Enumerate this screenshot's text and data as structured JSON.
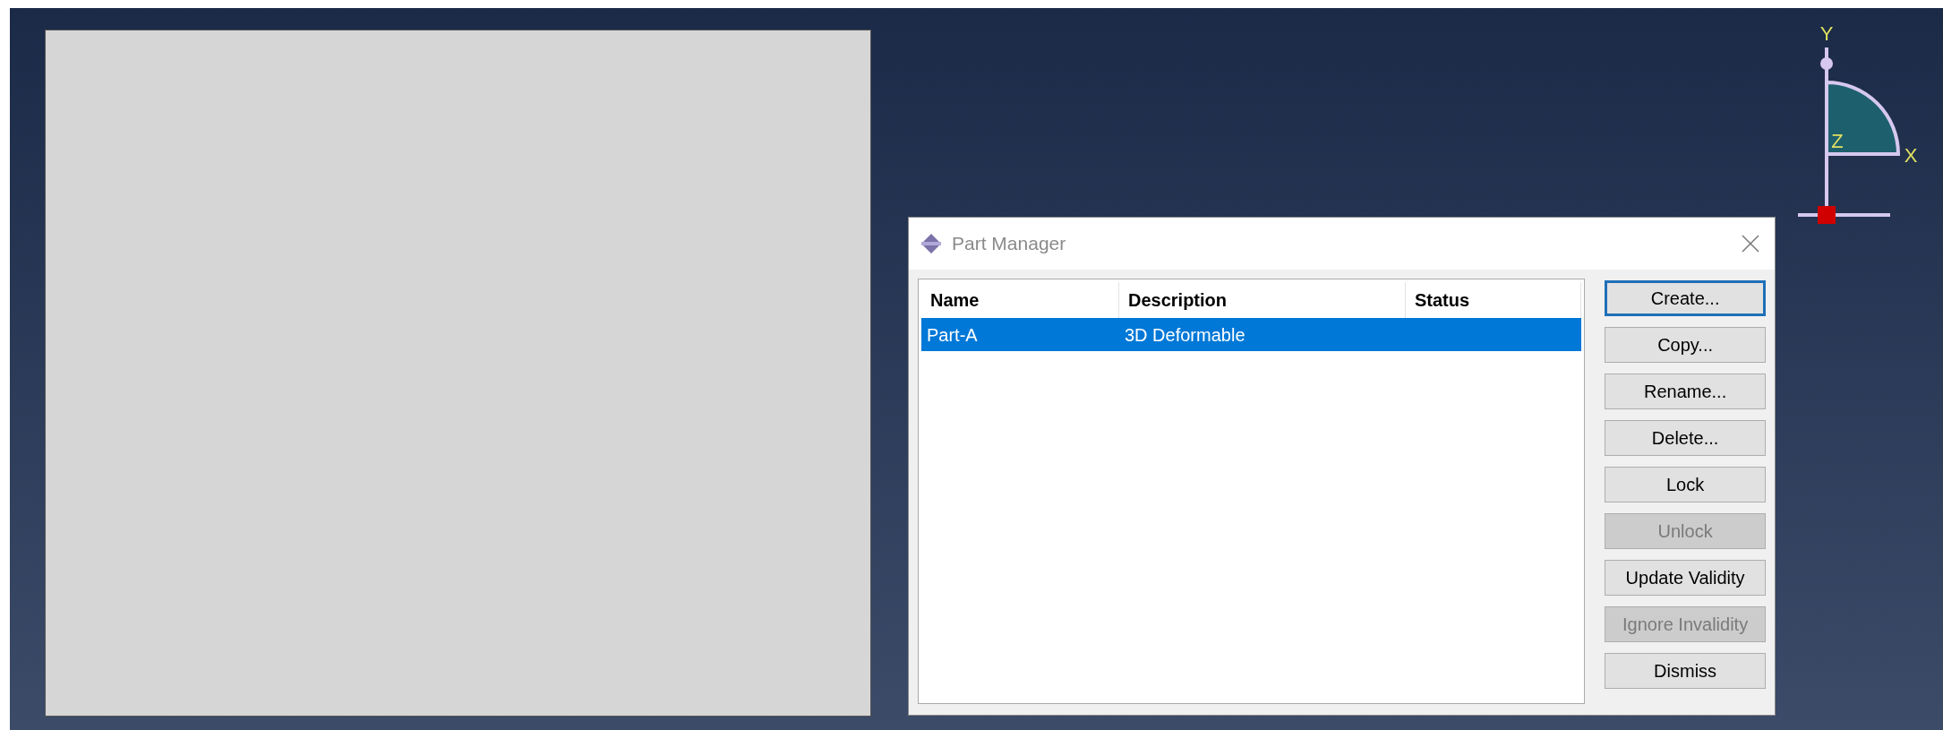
{
  "viewport": {
    "triad": {
      "axes": [
        "X",
        "Y",
        "Z"
      ]
    }
  },
  "dialog": {
    "title": "Part Manager",
    "table": {
      "columns": [
        "Name",
        "Description",
        "Status"
      ],
      "rows": [
        {
          "cells": [
            "Part-A",
            "3D Deformable",
            ""
          ],
          "selected": true
        }
      ]
    },
    "buttons": [
      {
        "label": "Create...",
        "disabled": false,
        "focused": true
      },
      {
        "label": "Copy...",
        "disabled": false,
        "focused": false
      },
      {
        "label": "Rename...",
        "disabled": false,
        "focused": false
      },
      {
        "label": "Delete...",
        "disabled": false,
        "focused": false
      },
      {
        "label": "Lock",
        "disabled": false,
        "focused": false
      },
      {
        "label": "Unlock",
        "disabled": true,
        "focused": false
      },
      {
        "label": "Update Validity",
        "disabled": false,
        "focused": false
      },
      {
        "label": "Ignore Invalidity",
        "disabled": true,
        "focused": false
      },
      {
        "label": "Dismiss",
        "disabled": false,
        "focused": false
      }
    ]
  }
}
